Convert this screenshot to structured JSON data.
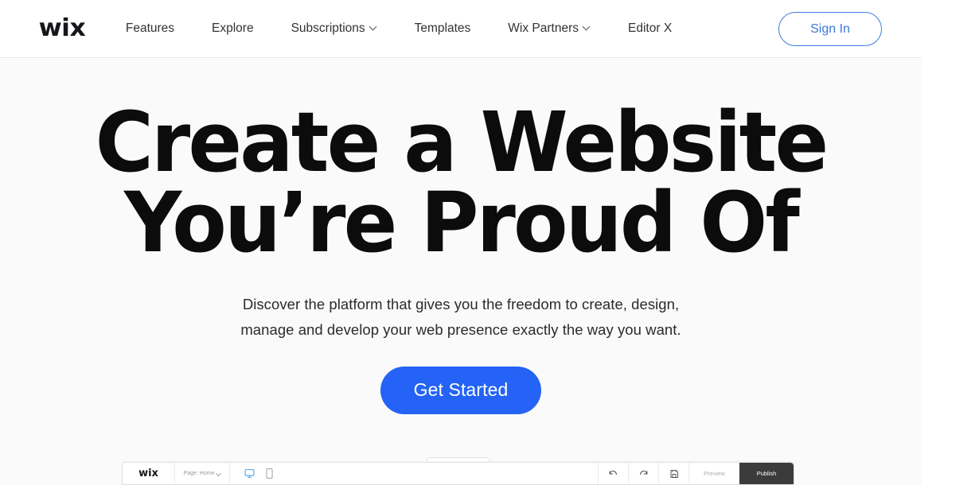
{
  "site": {
    "header": {
      "logo_text": "wix",
      "logo_icon": "wix-logo",
      "nav_items": [
        {
          "label": "Features",
          "has_dropdown": false
        },
        {
          "label": "Explore",
          "has_dropdown": false
        },
        {
          "label": "Subscriptions",
          "has_dropdown": true
        },
        {
          "label": "Templates",
          "has_dropdown": false
        },
        {
          "label": "Wix Partners",
          "has_dropdown": true
        },
        {
          "label": "Editor X",
          "has_dropdown": false
        }
      ],
      "sign_in_label": "Sign In",
      "sign_in_color": "#3b79d8"
    },
    "hero": {
      "headline_line1": "Create a Website",
      "headline_line2": "You’re Proud Of",
      "subhead_line1": "Discover the platform that gives you the freedom to create, design,",
      "subhead_line2": "manage and develop your web presence exactly the way you want.",
      "cta_label": "Get Started",
      "cta_color": "#2463f5",
      "background_color": "#fafafa"
    },
    "editor_preview": {
      "logo_text": "wix",
      "page_selector_label": "Page: Home",
      "view_desktop_icon": "desktop-monitor-icon",
      "view_mobile_icon": "mobile-phone-icon",
      "desktop_icon_color": "#4da3e8",
      "undo_icon": "undo-arrow-icon",
      "redo_icon": "redo-arrow-icon",
      "save_icon": "save-floppy-icon",
      "preview_label": "Preview",
      "publish_label": "Publish",
      "publish_bg_color": "#3b3b3b"
    }
  }
}
